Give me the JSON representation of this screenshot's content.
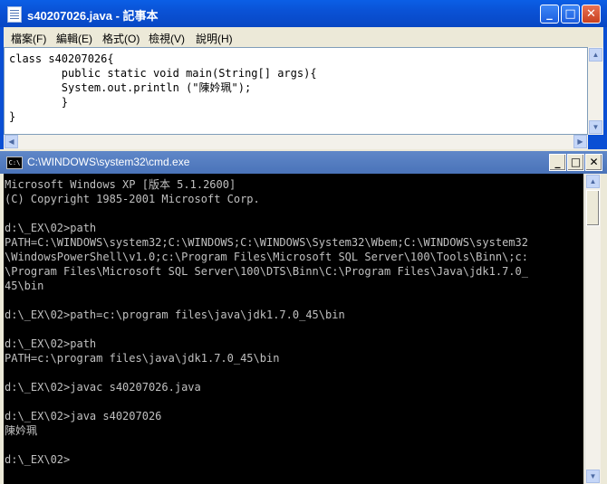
{
  "notepad": {
    "title": "s40207026.java - 記事本",
    "menu": [
      "檔案(F)",
      "編輯(E)",
      "格式(O)",
      "檢視(V)",
      "說明(H)"
    ],
    "content": "class s40207026{\n        public static void main(String[] args){\n        System.out.println (\"陳妗珮\");\n        }\n}"
  },
  "cmd": {
    "title": "C:\\WINDOWS\\system32\\cmd.exe",
    "icon_label": "C:\\",
    "output": "Microsoft Windows XP [版本 5.1.2600]\n(C) Copyright 1985-2001 Microsoft Corp.\n\nd:\\_EX\\02>path\nPATH=C:\\WINDOWS\\system32;C:\\WINDOWS;C:\\WINDOWS\\System32\\Wbem;C:\\WINDOWS\\system32\n\\WindowsPowerShell\\v1.0;c:\\Program Files\\Microsoft SQL Server\\100\\Tools\\Binn\\;c:\n\\Program Files\\Microsoft SQL Server\\100\\DTS\\Binn\\C:\\Program Files\\Java\\jdk1.7.0_\n45\\bin\n\nd:\\_EX\\02>path=c:\\program files\\java\\jdk1.7.0_45\\bin\n\nd:\\_EX\\02>path\nPATH=c:\\program files\\java\\jdk1.7.0_45\\bin\n\nd:\\_EX\\02>javac s40207026.java\n\nd:\\_EX\\02>java s40207026\n陳妗珮\n\nd:\\_EX\\02>"
  },
  "controls": {
    "minimize": "_",
    "maximize": "□",
    "close": "✕"
  },
  "scroll": {
    "up": "▲",
    "down": "▼",
    "left": "◀",
    "right": "▶"
  }
}
